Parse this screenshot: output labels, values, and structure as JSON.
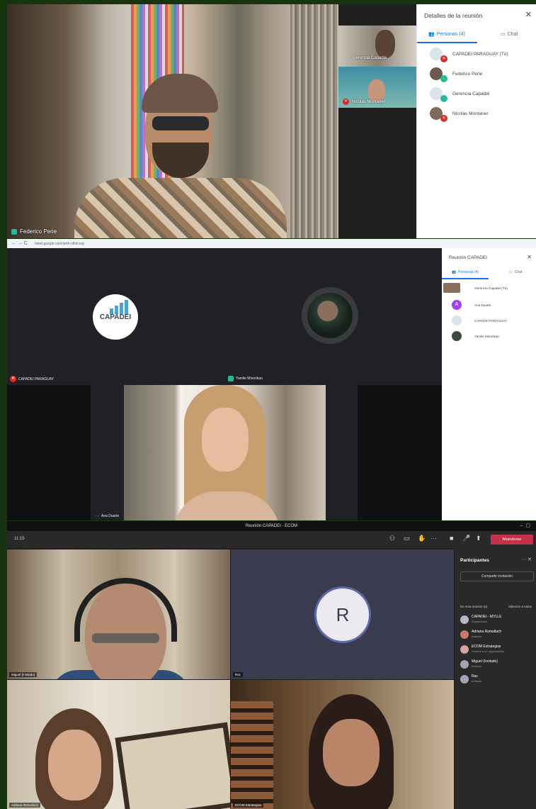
{
  "meet1": {
    "main_speaker": "Federico Perie",
    "thumbnails": [
      {
        "name": "Gerencia Capadei"
      },
      {
        "name": "Nicolas Montaner"
      }
    ],
    "panel": {
      "title": "Detalles de la reunión",
      "close": "✕",
      "tab_people": "Personas (4)",
      "tab_chat": "Chat",
      "participants": [
        {
          "name": "CAPADEI PARAGUAY (Tú)",
          "avatar_color": "#d9e3ea"
        },
        {
          "name": "Federico Perie",
          "avatar_color": "#6a5a4e"
        },
        {
          "name": "Gerencia Capadei",
          "avatar_color": "#d9e3ea"
        },
        {
          "name": "Nicolas Montaner",
          "avatar_color": "#7b6a5a"
        }
      ]
    }
  },
  "meet2": {
    "nav": "← → C",
    "url": "meet.google.com/amh-xthd-svp",
    "logo_text": "CAPADEI",
    "tile_left": "CAPADEI PARAGUAY",
    "tile_right": "Yamile Minorikan",
    "tile_bottom": "Ana Duarte",
    "panel": {
      "title": "Reunión CAPADEI",
      "tab_people": "Personas (4)",
      "tab_chat": "Chat",
      "participants": [
        {
          "name": "Gerencia Capadei (Tú)",
          "avatar_color": "#8a6f5d"
        },
        {
          "name": "Ana Duarte",
          "avatar_color": "#a142f4"
        },
        {
          "name": "CAPADEI PARAGUAY",
          "avatar_color": "#d9e3ea"
        },
        {
          "name": "Yamile Minorikan",
          "avatar_color": "#3a4a3c"
        }
      ]
    }
  },
  "teams": {
    "window_title": "Reunión CAPADEI - ECOM",
    "time": "11:15",
    "hangup": "Abandonar",
    "tiles": {
      "miguel": "Miguel (Invitado)",
      "r_initial": "R",
      "r_name": "Rac",
      "adriana": "Adriana Romalloch",
      "ecom": "ECOM Estrategias"
    },
    "panel": {
      "title": "Participantes",
      "invite": "Compartir invitación",
      "section": "En esta reunión (5)",
      "mute_all": "Silenciar a todos",
      "participants": [
        {
          "name": "CAPADEI - MYLLE",
          "role": "Organizador",
          "avatar_color": "#b8b3c7"
        },
        {
          "name": "Adriana Romallach",
          "role": "Invitado",
          "avatar_color": "#c37b6a"
        },
        {
          "name": "ECOM Estrategias",
          "role": "Externo a su organización",
          "avatar_color": "#d9a2a2"
        },
        {
          "name": "Miguel (Invitado)",
          "role": "Invitado",
          "avatar_color": "#a0a4ba"
        },
        {
          "name": "Rac",
          "role": "Invitado",
          "avatar_color": "#a0a4ba"
        }
      ]
    }
  }
}
